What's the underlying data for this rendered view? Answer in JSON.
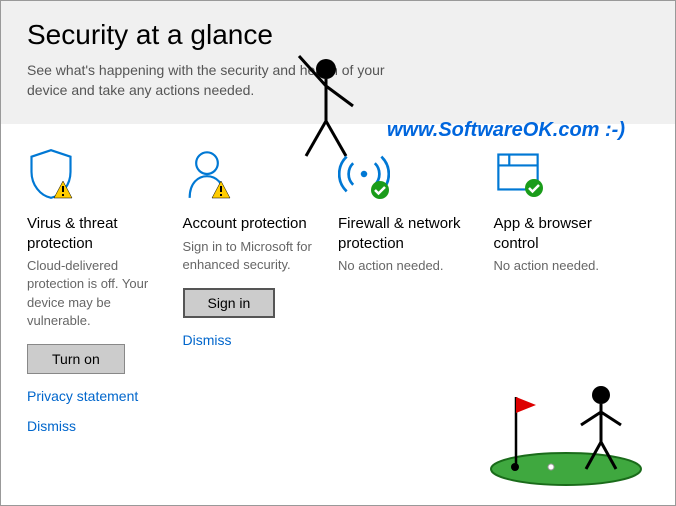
{
  "header": {
    "title": "Security at a glance",
    "subtitle": "See what's happening with the security and health of your device and take any actions needed."
  },
  "watermark": "www.SoftwareOK.com :-)",
  "tiles": [
    {
      "title": "Virus & threat protection",
      "desc": "Cloud-delivered protection is off. Your device may be vulnerable.",
      "button": "Turn on",
      "link1": "Privacy statement",
      "link2": "Dismiss"
    },
    {
      "title": "Account protection",
      "desc": "Sign in to Microsoft for enhanced security.",
      "button": "Sign in",
      "link1": "Dismiss"
    },
    {
      "title": "Firewall & network protection",
      "desc": "No action needed."
    },
    {
      "title": "App & browser control",
      "desc": "No action needed."
    }
  ]
}
